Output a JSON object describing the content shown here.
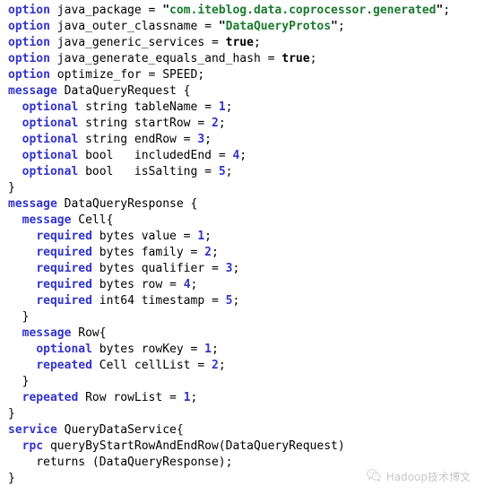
{
  "document": {
    "kind": "protobuf-source-listing",
    "background_color": "#ffffff",
    "syntax_colors": {
      "keyword": "#3333cc",
      "string": "#1a7a2e",
      "number": "#3333cc",
      "plain": "#000000"
    }
  },
  "code": {
    "lines": [
      [
        {
          "t": "option",
          "c": "kw"
        },
        {
          "t": " java_package = ",
          "c": "id"
        },
        {
          "t": "\"",
          "c": "qt"
        },
        {
          "t": "com.iteblog.data.coprocessor.generated",
          "c": "str"
        },
        {
          "t": "\"",
          "c": "qt"
        },
        {
          "t": ";",
          "c": "pun"
        }
      ],
      [
        {
          "t": "option",
          "c": "kw"
        },
        {
          "t": " java_outer_classname = ",
          "c": "id"
        },
        {
          "t": "\"",
          "c": "qt"
        },
        {
          "t": "DataQueryProtos",
          "c": "str"
        },
        {
          "t": "\"",
          "c": "qt"
        },
        {
          "t": ";",
          "c": "pun"
        }
      ],
      [
        {
          "t": "option",
          "c": "kw"
        },
        {
          "t": " java_generic_services = ",
          "c": "id"
        },
        {
          "t": "true",
          "c": "bool"
        },
        {
          "t": ";",
          "c": "pun"
        }
      ],
      [
        {
          "t": "option",
          "c": "kw"
        },
        {
          "t": " java_generate_equals_and_hash = ",
          "c": "id"
        },
        {
          "t": "true",
          "c": "bool"
        },
        {
          "t": ";",
          "c": "pun"
        }
      ],
      [
        {
          "t": "option",
          "c": "kw"
        },
        {
          "t": " optimize_for = SPEED;",
          "c": "id"
        }
      ],
      [
        {
          "t": "message",
          "c": "kw"
        },
        {
          "t": " DataQueryRequest {",
          "c": "id"
        }
      ],
      [
        {
          "t": "  ",
          "c": "id"
        },
        {
          "t": "optional",
          "c": "kw"
        },
        {
          "t": " string tableName = ",
          "c": "id"
        },
        {
          "t": "1",
          "c": "num"
        },
        {
          "t": ";",
          "c": "pun"
        }
      ],
      [
        {
          "t": "  ",
          "c": "id"
        },
        {
          "t": "optional",
          "c": "kw"
        },
        {
          "t": " string startRow = ",
          "c": "id"
        },
        {
          "t": "2",
          "c": "num"
        },
        {
          "t": ";",
          "c": "pun"
        }
      ],
      [
        {
          "t": "  ",
          "c": "id"
        },
        {
          "t": "optional",
          "c": "kw"
        },
        {
          "t": " string endRow = ",
          "c": "id"
        },
        {
          "t": "3",
          "c": "num"
        },
        {
          "t": ";",
          "c": "pun"
        }
      ],
      [
        {
          "t": "  ",
          "c": "id"
        },
        {
          "t": "optional",
          "c": "kw"
        },
        {
          "t": " bool   includedEnd = ",
          "c": "id"
        },
        {
          "t": "4",
          "c": "num"
        },
        {
          "t": ";",
          "c": "pun"
        }
      ],
      [
        {
          "t": "  ",
          "c": "id"
        },
        {
          "t": "optional",
          "c": "kw"
        },
        {
          "t": " bool   isSalting = ",
          "c": "id"
        },
        {
          "t": "5",
          "c": "num"
        },
        {
          "t": ";",
          "c": "pun"
        }
      ],
      [
        {
          "t": "}",
          "c": "pun"
        }
      ],
      [
        {
          "t": "message",
          "c": "kw"
        },
        {
          "t": " DataQueryResponse {",
          "c": "id"
        }
      ],
      [
        {
          "t": "  ",
          "c": "id"
        },
        {
          "t": "message",
          "c": "kw"
        },
        {
          "t": " Cell{",
          "c": "id"
        }
      ],
      [
        {
          "t": "    ",
          "c": "id"
        },
        {
          "t": "required",
          "c": "kw"
        },
        {
          "t": " bytes value = ",
          "c": "id"
        },
        {
          "t": "1",
          "c": "num"
        },
        {
          "t": ";",
          "c": "pun"
        }
      ],
      [
        {
          "t": "    ",
          "c": "id"
        },
        {
          "t": "required",
          "c": "kw"
        },
        {
          "t": " bytes family = ",
          "c": "id"
        },
        {
          "t": "2",
          "c": "num"
        },
        {
          "t": ";",
          "c": "pun"
        }
      ],
      [
        {
          "t": "    ",
          "c": "id"
        },
        {
          "t": "required",
          "c": "kw"
        },
        {
          "t": " bytes qualifier = ",
          "c": "id"
        },
        {
          "t": "3",
          "c": "num"
        },
        {
          "t": ";",
          "c": "pun"
        }
      ],
      [
        {
          "t": "    ",
          "c": "id"
        },
        {
          "t": "required",
          "c": "kw"
        },
        {
          "t": " bytes row = ",
          "c": "id"
        },
        {
          "t": "4",
          "c": "num"
        },
        {
          "t": ";",
          "c": "pun"
        }
      ],
      [
        {
          "t": "    ",
          "c": "id"
        },
        {
          "t": "required",
          "c": "kw"
        },
        {
          "t": " int64 timestamp = ",
          "c": "id"
        },
        {
          "t": "5",
          "c": "num"
        },
        {
          "t": ";",
          "c": "pun"
        }
      ],
      [
        {
          "t": "  }",
          "c": "pun"
        }
      ],
      [
        {
          "t": "  ",
          "c": "id"
        },
        {
          "t": "message",
          "c": "kw"
        },
        {
          "t": " Row{",
          "c": "id"
        }
      ],
      [
        {
          "t": "    ",
          "c": "id"
        },
        {
          "t": "optional",
          "c": "kw"
        },
        {
          "t": " bytes rowKey = ",
          "c": "id"
        },
        {
          "t": "1",
          "c": "num"
        },
        {
          "t": ";",
          "c": "pun"
        }
      ],
      [
        {
          "t": "    ",
          "c": "id"
        },
        {
          "t": "repeated",
          "c": "kw"
        },
        {
          "t": " Cell cellList = ",
          "c": "id"
        },
        {
          "t": "2",
          "c": "num"
        },
        {
          "t": ";",
          "c": "pun"
        }
      ],
      [
        {
          "t": "  }",
          "c": "pun"
        }
      ],
      [
        {
          "t": "  ",
          "c": "id"
        },
        {
          "t": "repeated",
          "c": "kw"
        },
        {
          "t": " Row rowList = ",
          "c": "id"
        },
        {
          "t": "1",
          "c": "num"
        },
        {
          "t": ";",
          "c": "pun"
        }
      ],
      [
        {
          "t": "}",
          "c": "pun"
        }
      ],
      [
        {
          "t": "service",
          "c": "kw"
        },
        {
          "t": " QueryDataService{",
          "c": "id"
        }
      ],
      [
        {
          "t": "  ",
          "c": "id"
        },
        {
          "t": "rpc",
          "c": "kw"
        },
        {
          "t": " queryByStartRowAndEndRow(DataQueryRequest)",
          "c": "id"
        }
      ],
      [
        {
          "t": "    returns (DataQueryResponse);",
          "c": "id"
        }
      ],
      [
        {
          "t": "}",
          "c": "pun"
        }
      ]
    ]
  },
  "watermark": {
    "icon": "wechat-icon",
    "text": "Hadoop技术博文"
  }
}
